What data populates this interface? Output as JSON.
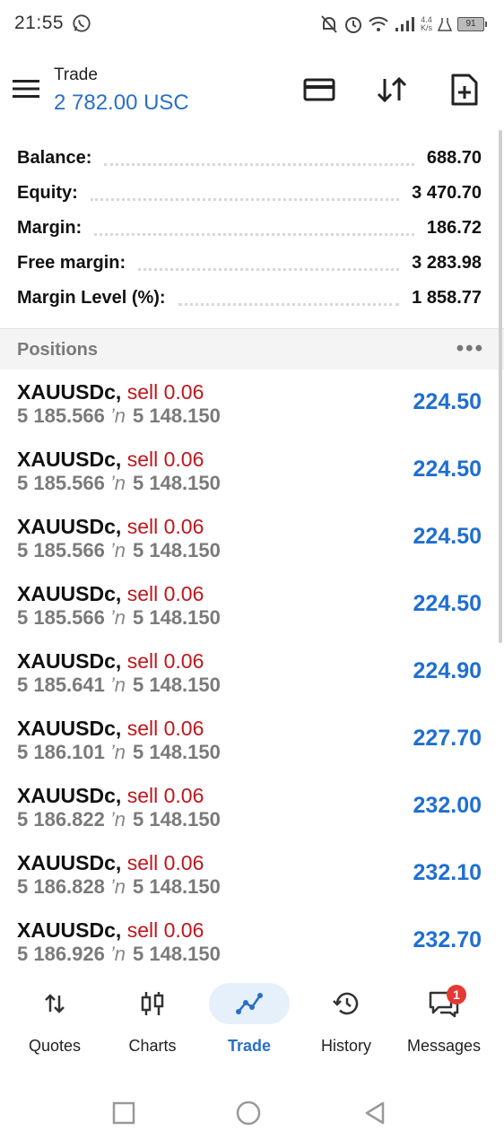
{
  "status_bar": {
    "time": "21:55",
    "net_speed_value": "4.4",
    "net_speed_unit": "K/s",
    "battery": "91",
    "icons": [
      "whatsapp-icon",
      "bell-off-icon",
      "alarm-icon",
      "wifi-icon",
      "signal-icon",
      "battery-icon"
    ]
  },
  "app_bar": {
    "title": "Trade",
    "subtitle": "2 782.00 USC",
    "actions": [
      "card-icon",
      "sort-arrows-icon",
      "new-order-icon"
    ]
  },
  "summary": [
    {
      "label": "Balance:",
      "value": "688.70"
    },
    {
      "label": "Equity:",
      "value": "3 470.70"
    },
    {
      "label": "Margin:",
      "value": "186.72"
    },
    {
      "label": "Free margin:",
      "value": "3 283.98"
    },
    {
      "label": "Margin Level (%):",
      "value": "1 858.77"
    }
  ],
  "positions": {
    "title": "Positions",
    "more": "•••",
    "items": [
      {
        "symbol": "XAUUSDc,",
        "direction": "sell 0.06",
        "open": "5 185.566",
        "arrow": "’n",
        "current": "5 148.150",
        "profit": "224.50"
      },
      {
        "symbol": "XAUUSDc,",
        "direction": "sell 0.06",
        "open": "5 185.566",
        "arrow": "’n",
        "current": "5 148.150",
        "profit": "224.50"
      },
      {
        "symbol": "XAUUSDc,",
        "direction": "sell 0.06",
        "open": "5 185.566",
        "arrow": "’n",
        "current": "5 148.150",
        "profit": "224.50"
      },
      {
        "symbol": "XAUUSDc,",
        "direction": "sell 0.06",
        "open": "5 185.566",
        "arrow": "’n",
        "current": "5 148.150",
        "profit": "224.50"
      },
      {
        "symbol": "XAUUSDc,",
        "direction": "sell 0.06",
        "open": "5 185.641",
        "arrow": "’n",
        "current": "5 148.150",
        "profit": "224.90"
      },
      {
        "symbol": "XAUUSDc,",
        "direction": "sell 0.06",
        "open": "5 186.101",
        "arrow": "’n",
        "current": "5 148.150",
        "profit": "227.70"
      },
      {
        "symbol": "XAUUSDc,",
        "direction": "sell 0.06",
        "open": "5 186.822",
        "arrow": "’n",
        "current": "5 148.150",
        "profit": "232.00"
      },
      {
        "symbol": "XAUUSDc,",
        "direction": "sell 0.06",
        "open": "5 186.828",
        "arrow": "’n",
        "current": "5 148.150",
        "profit": "232.10"
      },
      {
        "symbol": "XAUUSDc,",
        "direction": "sell 0.06",
        "open": "5 186.926",
        "arrow": "’n",
        "current": "5 148.150",
        "profit": "232.70"
      }
    ]
  },
  "bottom_nav": {
    "items": [
      {
        "label": "Quotes",
        "icon": "quotes-icon"
      },
      {
        "label": "Charts",
        "icon": "candlestick-icon"
      },
      {
        "label": "Trade",
        "icon": "trade-line-icon",
        "active": true
      },
      {
        "label": "History",
        "icon": "history-icon"
      },
      {
        "label": "Messages",
        "icon": "messages-icon",
        "badge": "1"
      }
    ]
  },
  "colors": {
    "accent": "#2a6fc8",
    "sell": "#c0161c",
    "profit": "#1f6fd0",
    "badge": "#e53935"
  }
}
